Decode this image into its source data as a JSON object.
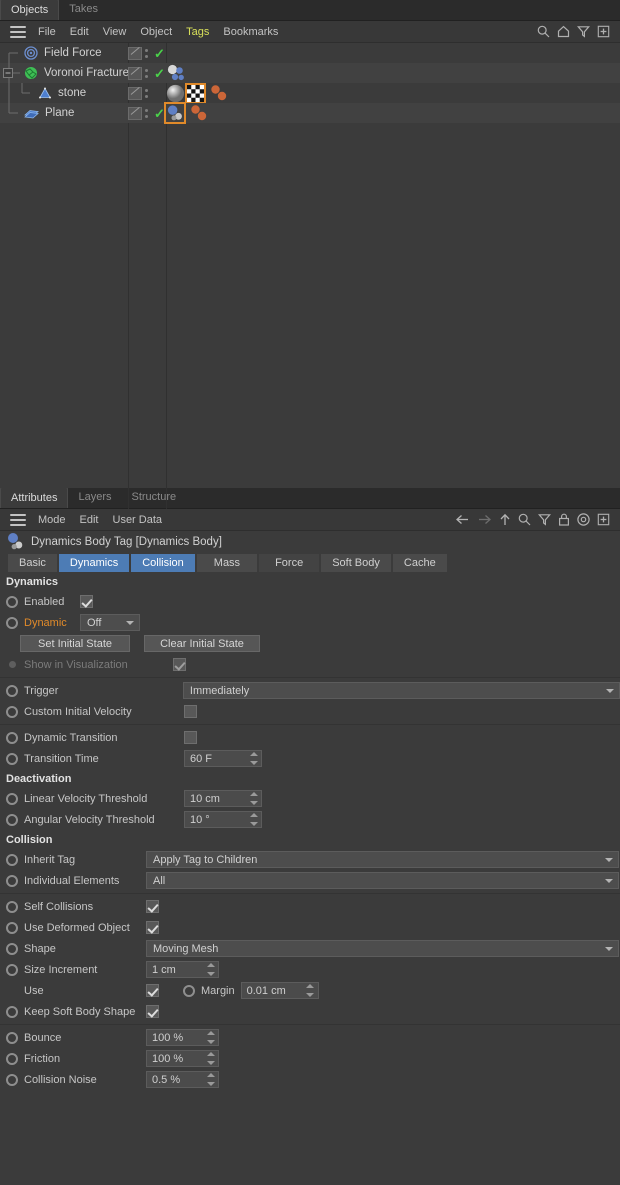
{
  "object_manager": {
    "tabs": [
      {
        "label": "Objects",
        "active": true
      },
      {
        "label": "Takes",
        "active": false
      }
    ],
    "menu": [
      "File",
      "Edit",
      "View",
      "Object",
      "Tags",
      "Bookmarks"
    ],
    "menu_highlight": "Tags",
    "toolbar_icons": [
      "search-icon",
      "home-icon",
      "filter-icon",
      "add-layout-icon"
    ],
    "rows": [
      {
        "name": "Field Force",
        "icon": "field-force-icon",
        "depth": 0,
        "visdots": true,
        "check": true,
        "tags": []
      },
      {
        "name": "Voronoi Fracture",
        "icon": "voronoi-fracture-icon",
        "depth": 0,
        "visdots": true,
        "check": true,
        "expander": "minus",
        "tags": [
          "dynamics-body-tag",
          "connector-tag"
        ]
      },
      {
        "name": "stone",
        "icon": "stone-object-icon",
        "depth": 1,
        "visdots": true,
        "check": false,
        "tags": [
          "material-tag",
          "checker-texture-tag",
          "dynamics-body-tag"
        ]
      },
      {
        "name": "Plane",
        "icon": "plane-object-icon",
        "depth": 0,
        "visdots": true,
        "check": true,
        "tags": [
          "dynamics-body-tag-selected",
          "dynamics-body-tag"
        ]
      }
    ]
  },
  "attributes": {
    "tabs": [
      {
        "label": "Attributes",
        "active": true
      },
      {
        "label": "Layers",
        "active": false
      },
      {
        "label": "Structure",
        "active": false
      }
    ],
    "menu": [
      "Mode",
      "Edit",
      "User Data"
    ],
    "toolbar_icons": [
      "back-arrow-icon",
      "forward-arrow-icon",
      "up-arrow-icon",
      "search-icon",
      "filter-icon",
      "lock-icon",
      "target-icon",
      "add-layout-icon"
    ],
    "title": "Dynamics Body Tag [Dynamics Body]",
    "title_icon": "dynamics-body-tag-icon",
    "object_tabs": [
      {
        "label": "Basic",
        "state": "normal"
      },
      {
        "label": "Dynamics",
        "state": "selected"
      },
      {
        "label": "Collision",
        "state": "selected"
      },
      {
        "label": "Mass",
        "state": "normal"
      },
      {
        "label": "Force",
        "state": "dim"
      },
      {
        "label": "Soft Body",
        "state": "normal"
      },
      {
        "label": "Cache",
        "state": "normal"
      }
    ],
    "sections": {
      "dynamics": {
        "header": "Dynamics",
        "enabled": {
          "label": "Enabled",
          "checked": true
        },
        "dynamic": {
          "label": "Dynamic",
          "value": "Off",
          "highlight": true
        },
        "set_initial_state": "Set Initial State",
        "clear_initial_state": "Clear Initial State",
        "show_in_visualization": {
          "label": "Show in Visualization",
          "checked": true,
          "disabled": true
        },
        "trigger": {
          "label": "Trigger",
          "value": "Immediately"
        },
        "custom_initial_velocity": {
          "label": "Custom Initial Velocity",
          "checked": false
        },
        "dynamic_transition": {
          "label": "Dynamic Transition",
          "checked": false
        },
        "transition_time": {
          "label": "Transition Time",
          "value": "60 F"
        }
      },
      "deactivation": {
        "header": "Deactivation",
        "linear_velocity_threshold": {
          "label": "Linear Velocity Threshold",
          "value": "10 cm"
        },
        "angular_velocity_threshold": {
          "label": "Angular Velocity Threshold",
          "value": "10 °"
        }
      },
      "collision": {
        "header": "Collision",
        "inherit_tag": {
          "label": "Inherit Tag",
          "value": "Apply Tag to Children"
        },
        "individual_elements": {
          "label": "Individual Elements",
          "value": "All"
        },
        "self_collisions": {
          "label": "Self Collisions",
          "checked": true
        },
        "use_deformed_object": {
          "label": "Use Deformed Object",
          "checked": true
        },
        "shape": {
          "label": "Shape",
          "value": "Moving Mesh"
        },
        "size_increment": {
          "label": "Size Increment",
          "value": "1 cm"
        },
        "use": {
          "label": "Use",
          "checked": true
        },
        "margin": {
          "label": "Margin",
          "value": "0.01 cm"
        },
        "keep_soft_body_shape": {
          "label": "Keep Soft Body Shape",
          "checked": true
        },
        "bounce": {
          "label": "Bounce",
          "value": "100 %"
        },
        "friction": {
          "label": "Friction",
          "value": "100 %"
        },
        "collision_noise": {
          "label": "Collision Noise",
          "value": "0.5 %"
        }
      }
    }
  },
  "colors": {
    "panel_bg": "#3b3b3b",
    "row_alt": "#414141",
    "accent_blue": "#4d7cb5",
    "accent_orange": "#e08a2a",
    "menu_highlight": "#d8e05a",
    "check_green": "#4ad24a"
  }
}
